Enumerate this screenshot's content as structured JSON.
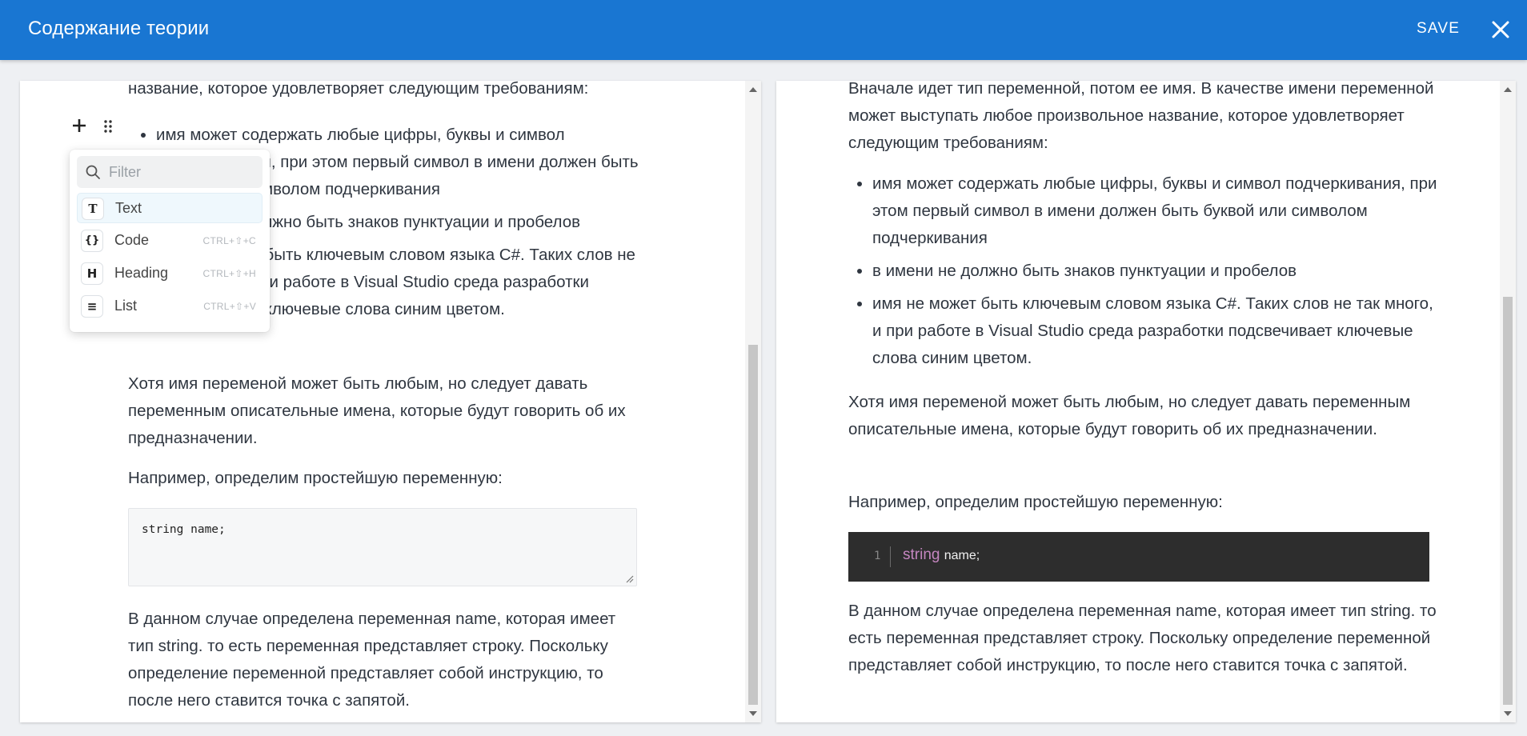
{
  "header": {
    "title": "Содержание теории",
    "save_label": "SAVE",
    "close_icon": "close-icon",
    "background": "#1976d2"
  },
  "editor": {
    "intro_partial": "название, которое удовлетворяет следующим требованиям:",
    "bullets": [
      "имя может содержать любые цифры, буквы и символ подчеркивания, при этом первый символ в имени должен быть буквой или символом подчеркивания",
      "в имени не должно быть знаков пунктуации и пробелов",
      "имя не может быть ключевым словом языка C#. Таких слов не так много, и при работе в Visual Studio среда разработки подсвечивает ключевые слова синим цветом."
    ],
    "para1": "Хотя имя переменой может быть любым, но следует давать переменным описательные имена, которые будут говорить об их предназначении.",
    "para2": "Например, определим простейшую переменную:",
    "code": "string name;",
    "para3": "В данном случае определена переменная name, которая имеет тип string. то есть переменная представляет строку. Поскольку определение переменной представляет собой инструкцию, то после него ставится точка с запятой."
  },
  "block_menu": {
    "filter_placeholder": "Filter",
    "items": [
      {
        "label": "Text",
        "icon": "T",
        "shortcut": "",
        "active": true
      },
      {
        "label": "Code",
        "icon": "{}",
        "shortcut": "CTRL+⇧+C",
        "active": false
      },
      {
        "label": "Heading",
        "icon": "H",
        "shortcut": "CTRL+⇧+H",
        "active": false
      },
      {
        "label": "List",
        "icon": "≡",
        "shortcut": "CTRL+⇧+V",
        "active": false
      }
    ]
  },
  "preview": {
    "intro": "Вначале идет тип переменной, потом ее имя. В качестве имени переменной может выступать любое произвольное название, которое удовлетворяет следующим требованиям:",
    "bullets": [
      "имя может содержать любые цифры, буквы и символ подчеркивания, при этом первый символ в имени должен быть буквой или символом подчеркивания",
      "в имени не должно быть знаков пунктуации и пробелов",
      "имя не может быть ключевым словом языка C#. Таких слов не так много, и при работе в Visual Studio среда разработки подсвечивает ключевые слова синим цветом."
    ],
    "para1": "Хотя имя переменой может быть любым, но следует давать переменным описательные имена, которые будут говорить об их предназначении.",
    "para2": "Например, определим простейшую переменную:",
    "code_line_number": "1",
    "code_keyword": "string",
    "code_rest": "name;",
    "para3": "В данном случае определена переменная name, которая имеет тип string. то есть переменная представляет строку. Поскольку определение переменной представляет собой инструкцию, то после него ставится точка с запятой."
  }
}
